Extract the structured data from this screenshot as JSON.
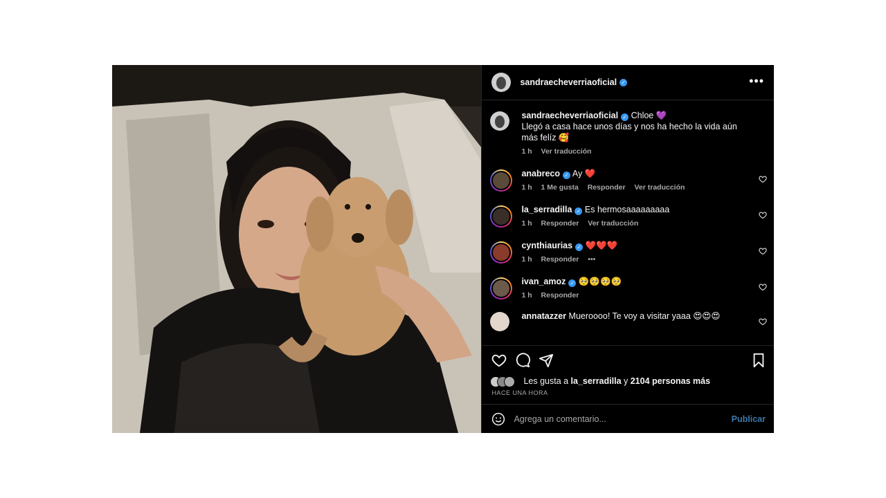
{
  "post": {
    "username": "sandraecheverriaoficial",
    "more_icon": "more-horizontal-icon"
  },
  "caption": {
    "username": "sandraecheverriaoficial",
    "line1": "Chloe 💜",
    "line2": "Llegó a casa hace unos días y nos ha hecho la vida aún más felíz 🥰",
    "time": "1 h",
    "translate": "Ver traducción"
  },
  "comments": [
    {
      "username": "anabreco",
      "text": "Ay ❤️",
      "time": "1 h",
      "likes": "1 Me gusta",
      "reply": "Responder",
      "translate": "Ver traducción"
    },
    {
      "username": "la_serradilla",
      "text": "Es hermosaaaaaaaaa",
      "time": "1 h",
      "reply": "Responder",
      "translate": "Ver traducción"
    },
    {
      "username": "cynthiaurias",
      "text": "❤️❤️❤️",
      "time": "1 h",
      "reply": "Responder",
      "more": "•••"
    },
    {
      "username": "ivan_amoz",
      "text": "🥺🥺🥺🥺",
      "time": "1 h",
      "reply": "Responder"
    },
    {
      "username": "annatazzer",
      "text": "Mueroooo! Te voy a visitar yaaa 😍😍😍"
    }
  ],
  "likes": {
    "prefix": "Les gusta a ",
    "user": "la_serradilla",
    "mid": " y ",
    "count": "2104 personas más"
  },
  "timestamp": "HACE UNA HORA",
  "add_comment": {
    "placeholder": "Agrega un comentario...",
    "publish": "Publicar"
  },
  "colors": {
    "background": "#000000",
    "text": "#f5f5f5",
    "muted": "#a8a8a8",
    "verified": "#3897f0",
    "publish": "#3e78a8"
  }
}
